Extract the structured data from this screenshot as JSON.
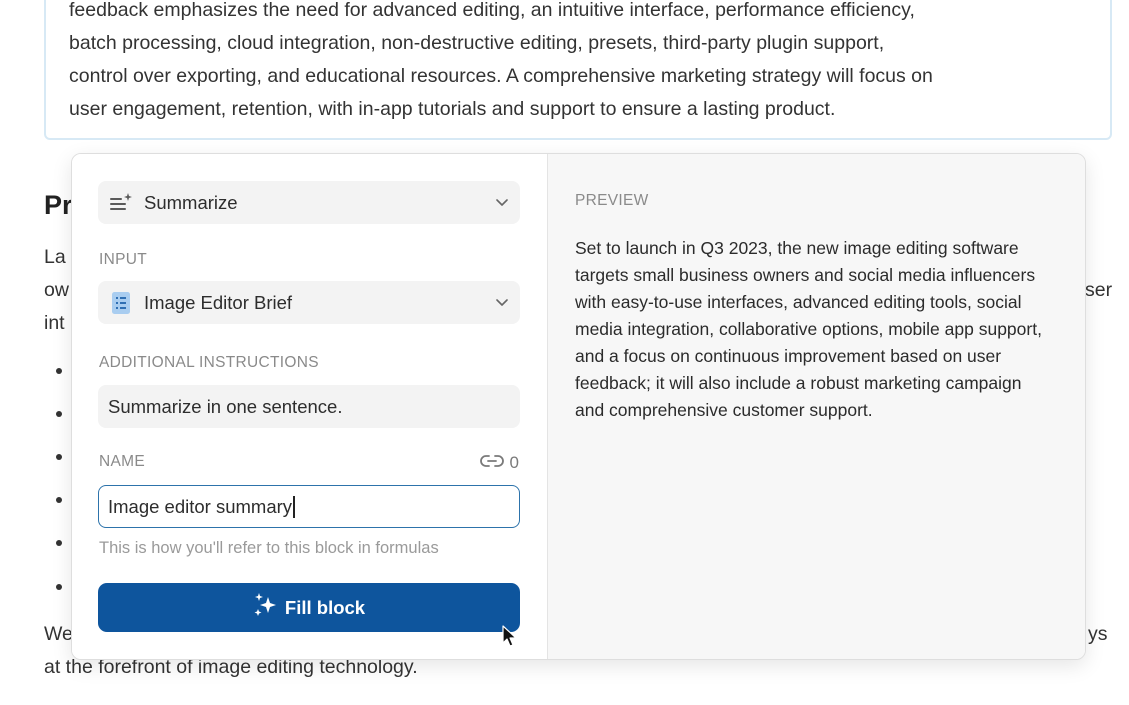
{
  "document": {
    "block_lines": [
      "feedback emphasizes the need for advanced editing, an intuitive interface, performance efficiency,",
      "batch processing, cloud integration, non-destructive editing, presets, third-party plugin support,",
      "control over exporting, and educational resources. A comprehensive marketing strategy will focus on",
      "user engagement, retention, with in-app tutorials and support to ensure a lasting product."
    ],
    "heading_fragment": "Pr",
    "line_fragments": {
      "la": "La",
      "ow": "ow",
      "int": "int",
      "ser": "ser",
      "we": "We",
      "ys": "ys"
    },
    "closing_line": "at the forefront of image editing technology."
  },
  "panel": {
    "action_select": {
      "label": "Summarize",
      "icon": "summarize-icon"
    },
    "input_label": "INPUT",
    "input_select": {
      "label": "Image Editor Brief",
      "icon": "document-icon"
    },
    "instructions_label": "ADDITIONAL INSTRUCTIONS",
    "instructions_value": "Summarize in one sentence.",
    "name_label": "NAME",
    "link_count": "0",
    "name_value": "Image editor summary",
    "name_hint": "This is how you'll refer to this block in formulas",
    "fill_button": "Fill block",
    "preview_label": "PREVIEW",
    "preview_text": "Set to launch in Q3 2023, the new image editing software targets small business owners and social media influencers with easy-to-use interfaces, advanced editing tools, social media integration, collaborative options, mobile app support, and a focus on continuous improvement based on user feedback; it will also include a robust marketing campaign and comprehensive customer support.",
    "colors": {
      "accent": "#0e559d",
      "input_border": "#2d73ab"
    }
  }
}
